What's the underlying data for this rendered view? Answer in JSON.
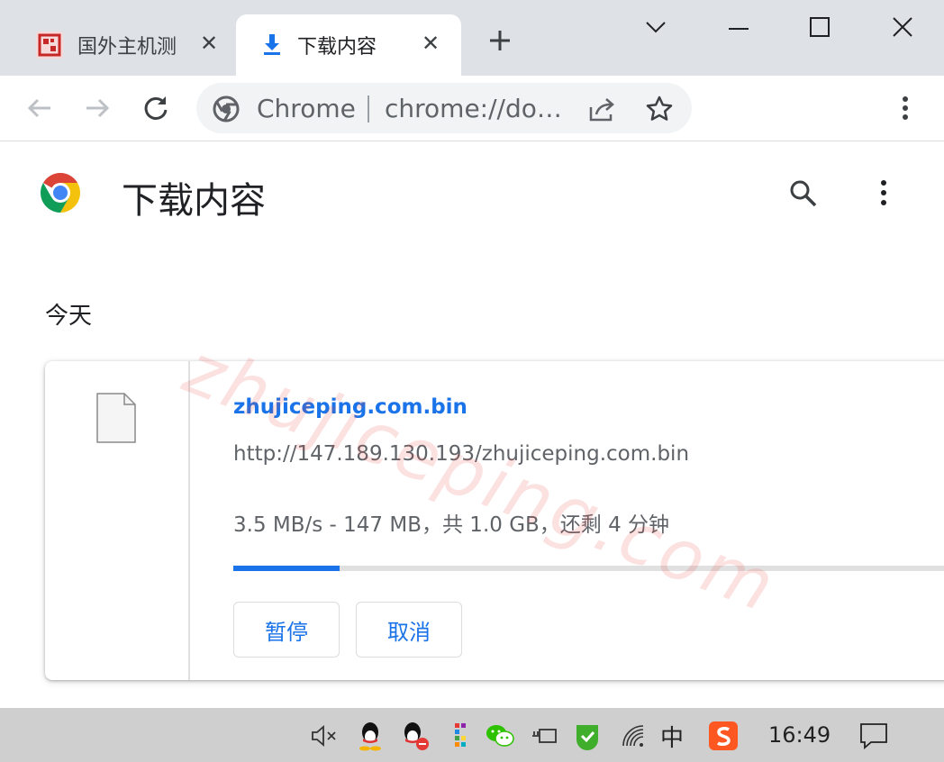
{
  "tabs": [
    {
      "title": "国外主机测",
      "close": "✕",
      "icon": "site-favicon"
    },
    {
      "title": "下载内容",
      "close": "✕",
      "icon": "download-icon"
    }
  ],
  "new_tab": "+",
  "window_controls": [
    "tab-search",
    "minimize",
    "maximize",
    "close"
  ],
  "omnibox": {
    "chip": "Chrome",
    "url": "chrome://do…"
  },
  "page": {
    "title": "下载内容",
    "section": "今天"
  },
  "download": {
    "filename": "zhujiceping.com.bin",
    "url": "http://147.189.130.193/zhujiceping.com.bin",
    "status": "3.5 MB/s - 147 MB，共 1.0 GB，还剩 4 分钟",
    "progress": 0.14,
    "pause_label": "暂停",
    "cancel_label": "取消"
  },
  "watermark": "zhujiceping.com",
  "taskbar": {
    "time": "16:49",
    "ime": "中",
    "tray_icons": [
      "mute-icon",
      "qq-icon",
      "qq-dnd-icon",
      "app-icon",
      "wechat-icon",
      "power-icon",
      "security-icon",
      "wifi-icon",
      "ime-icon",
      "sogou-icon",
      "notification-icon"
    ]
  },
  "colors": {
    "accent": "#1a73e8",
    "tabstrip": "#dee1e6",
    "taskbar": "#cfcfcf"
  }
}
